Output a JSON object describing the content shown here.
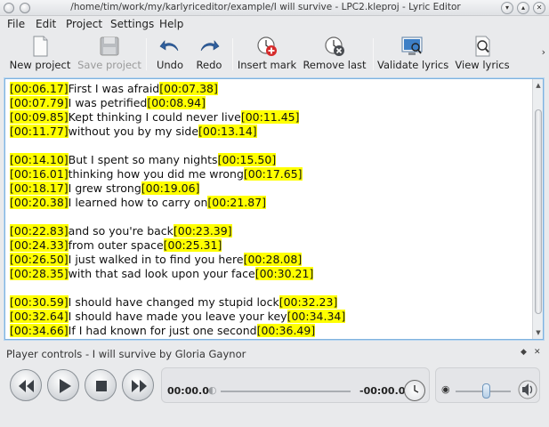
{
  "window": {
    "title": "/home/tim/work/my/karlyriceditor/example/I will survive - LPC2.kleproj - Lyric Editor"
  },
  "menu": [
    "File",
    "Edit",
    "Project",
    "Settings",
    "Help"
  ],
  "toolbar": {
    "new_project": "New project",
    "save_project": "Save project",
    "undo": "Undo",
    "redo": "Redo",
    "insert_mark": "Insert mark",
    "remove_last": "Remove last",
    "validate_lyrics": "Validate lyrics",
    "view_lyrics": "View lyrics",
    "more": "›"
  },
  "lyrics": [
    {
      "start": "[00:06.17]",
      "text": "First I was afraid",
      "end": "[00:07.38]"
    },
    {
      "start": "[00:07.79]",
      "text": "I was petrified",
      "end": "[00:08.94]"
    },
    {
      "start": "[00:09.85]",
      "text": "Kept thinking I could never live",
      "end": "[00:11.45]"
    },
    {
      "start": "[00:11.77]",
      "text": "without you by my side",
      "end": "[00:13.14]"
    },
    null,
    {
      "start": "[00:14.10]",
      "text": "But I spent so many nights",
      "end": "[00:15.50]"
    },
    {
      "start": "[00:16.01]",
      "text": "thinking how you did me wrong",
      "end": "[00:17.65]"
    },
    {
      "start": "[00:18.17]",
      "text": "I grew strong",
      "end": "[00:19.06]"
    },
    {
      "start": "[00:20.38]",
      "text": "I learned how to carry on",
      "end": "[00:21.87]"
    },
    null,
    {
      "start": "[00:22.83]",
      "text": "and so you're back",
      "end": "[00:23.39]"
    },
    {
      "start": "[00:24.33]",
      "text": "from outer space",
      "end": "[00:25.31]"
    },
    {
      "start": "[00:26.50]",
      "text": "I just walked in to find you here",
      "end": "[00:28.08]"
    },
    {
      "start": "[00:28.35]",
      "text": "with that sad look upon your face",
      "end": "[00:30.21]"
    },
    null,
    {
      "start": "[00:30.59]",
      "text": "I should have changed my stupid lock",
      "end": "[00:32.23]"
    },
    {
      "start": "[00:32.64]",
      "text": "I should have made you leave your key",
      "end": "[00:34.34]"
    },
    {
      "start": "[00:34.66]",
      "text": "If I had known for just one second",
      "end": "[00:36.49]"
    }
  ],
  "player": {
    "dock_title": "Player controls - I will survive by Gloria Gaynor",
    "elapsed": "00:00.0",
    "remaining": "-00:00.0",
    "volume": 0.55
  },
  "colors": {
    "timestamp_highlight": "#ffff00",
    "editor_focus": "#7fb2de"
  }
}
